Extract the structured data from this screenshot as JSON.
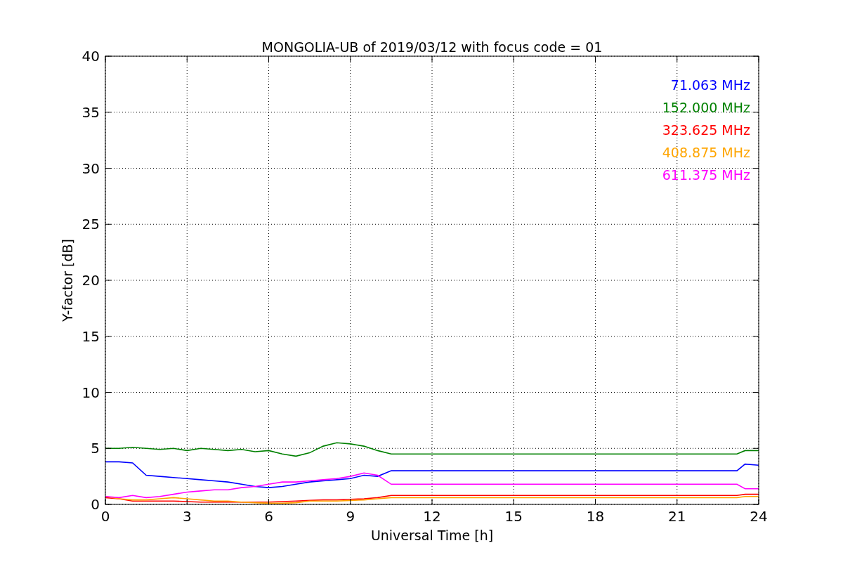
{
  "figure": {
    "chart_data": {
      "type": "line",
      "title": "MONGOLIA-UB of 2019/03/12 with focus code = 01",
      "xlabel": "Universal Time [h]",
      "ylabel": "Y-factor [dB]",
      "x": [
        0,
        0.5,
        1,
        1.5,
        2,
        2.5,
        3,
        3.5,
        4,
        4.5,
        5,
        5.5,
        6,
        6.5,
        7,
        7.5,
        8,
        8.5,
        9,
        9.5,
        10,
        10.5,
        23.2,
        23.5,
        24
      ],
      "series": [
        {
          "name": "71.063 MHz",
          "color": "#0000ff",
          "values": [
            3.8,
            3.8,
            3.7,
            2.6,
            2.5,
            2.4,
            2.3,
            2.2,
            2.1,
            2.0,
            1.8,
            1.6,
            1.5,
            1.6,
            1.8,
            2.0,
            2.1,
            2.2,
            2.3,
            2.6,
            2.5,
            3.0,
            3.0,
            3.6,
            3.5
          ]
        },
        {
          "name": "152.000 MHz",
          "color": "#008000",
          "values": [
            5,
            5,
            5.1,
            5,
            4.9,
            5,
            4.8,
            5,
            4.9,
            4.8,
            4.9,
            4.7,
            4.8,
            4.5,
            4.3,
            4.6,
            5.2,
            5.5,
            5.4,
            5.2,
            4.8,
            4.5,
            4.5,
            4.8,
            4.8
          ]
        },
        {
          "name": "323.625 MHz",
          "color": "#ff0000",
          "values": [
            0.6,
            0.5,
            0.3,
            0.3,
            0.3,
            0.3,
            0.25,
            0.2,
            0.2,
            0.2,
            0.2,
            0.2,
            0.2,
            0.25,
            0.3,
            0.35,
            0.4,
            0.4,
            0.45,
            0.5,
            0.6,
            0.8,
            0.8,
            0.9,
            0.9
          ]
        },
        {
          "name": "408.875 MHz",
          "color": "#ffa500",
          "values": [
            0.7,
            0.5,
            0.4,
            0.4,
            0.5,
            0.6,
            0.5,
            0.4,
            0.3,
            0.3,
            0.2,
            0.15,
            0.1,
            0.1,
            0.15,
            0.3,
            0.3,
            0.3,
            0.35,
            0.4,
            0.5,
            0.6,
            0.6,
            0.7,
            0.7
          ]
        },
        {
          "name": "611.375 MHz",
          "color": "#ff00ff",
          "values": [
            0.7,
            0.6,
            0.8,
            0.6,
            0.7,
            0.9,
            1.1,
            1.2,
            1.3,
            1.3,
            1.5,
            1.6,
            1.8,
            2.0,
            2.0,
            2.1,
            2.2,
            2.3,
            2.5,
            2.8,
            2.6,
            1.8,
            1.8,
            1.4,
            1.4
          ]
        }
      ],
      "grid": true,
      "xlim": [
        0,
        24
      ],
      "ylim": [
        0,
        40
      ],
      "xticks": [
        0,
        3,
        6,
        9,
        12,
        15,
        18,
        21,
        24
      ],
      "yticks": [
        0,
        5,
        10,
        15,
        20,
        25,
        30,
        35,
        40
      ]
    }
  }
}
